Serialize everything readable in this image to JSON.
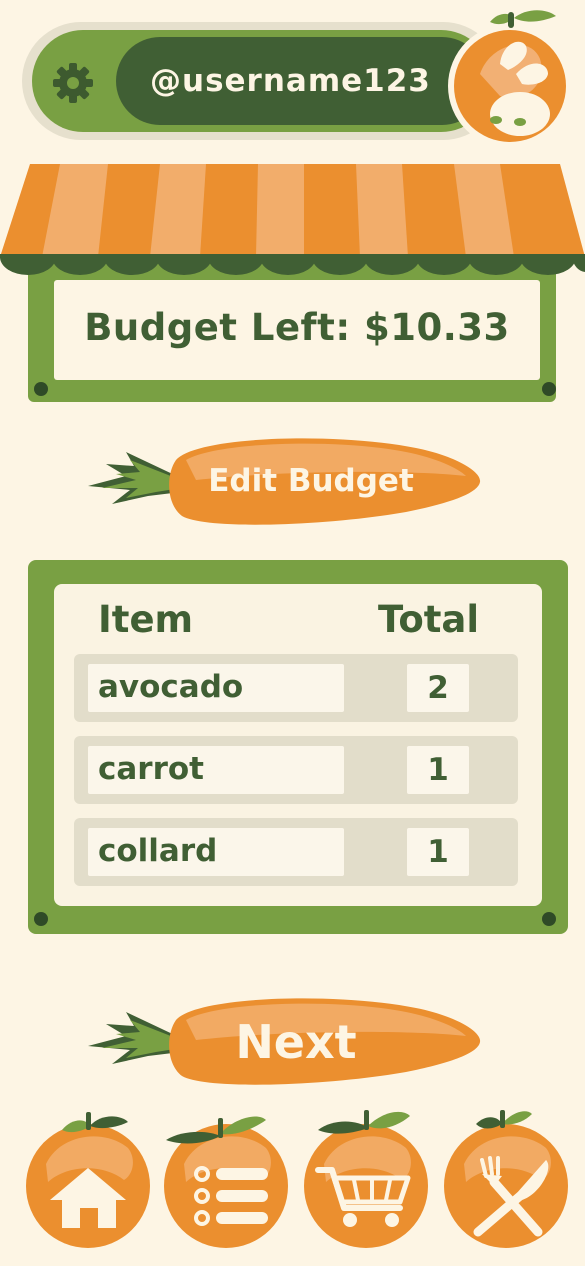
{
  "header": {
    "username": "@username123",
    "settings_icon": "gear-icon",
    "avatar_icon": "orange-bunny-avatar"
  },
  "budget": {
    "text": "Budget Left: $10.33"
  },
  "edit_budget_button": {
    "label": "Edit Budget"
  },
  "table": {
    "headers": {
      "item": "Item",
      "total": "Total"
    },
    "rows": [
      {
        "name": "avocado",
        "total": "2"
      },
      {
        "name": "carrot",
        "total": "1"
      },
      {
        "name": "collard",
        "total": "1"
      }
    ]
  },
  "next_button": {
    "label": "Next"
  },
  "bottom_nav": {
    "items": [
      {
        "icon": "home-icon"
      },
      {
        "icon": "list-icon"
      },
      {
        "icon": "cart-icon"
      },
      {
        "icon": "fork-knife-icon"
      }
    ]
  },
  "colors": {
    "background": "#fdf5e4",
    "green": "#79a043",
    "dark_green": "#405f34",
    "orange": "#eb8f2f",
    "light_orange": "#f2aa63"
  }
}
